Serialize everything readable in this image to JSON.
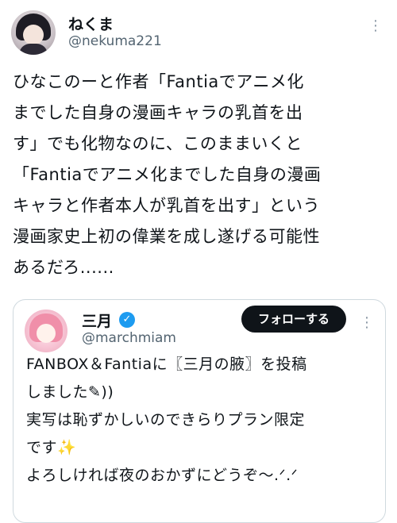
{
  "author": {
    "name": "ねくま",
    "handle": "@nekuma221"
  },
  "more_icon": "more-horizontal-icon",
  "tweet_lines": [
    "ひなこのーと作者「Fantiaでアニメ化",
    "までした自身の漫画キャラの乳首を出",
    "す」でも化物なのに、このままいくと",
    "「Fantiaでアニメ化までした自身の漫画",
    "キャラと作者本人が乳首を出す」という",
    "漫画家史上初の偉業を成し遂げる可能性",
    "あるだろ......"
  ],
  "quote": {
    "name": "三月",
    "verified_icon": "verified-badge-icon",
    "handle": "@marchmiam",
    "follow_label": "フォローする",
    "lines": [
      "FANBOX＆Fantiaに〖三月の腋〗を投稿",
      "しました✎))",
      "実写は恥ずかしいのできらりプラン限定",
      "です✨",
      "よろしければ夜のおかずにどうぞ〜.ᐟ.ᐟ"
    ]
  }
}
